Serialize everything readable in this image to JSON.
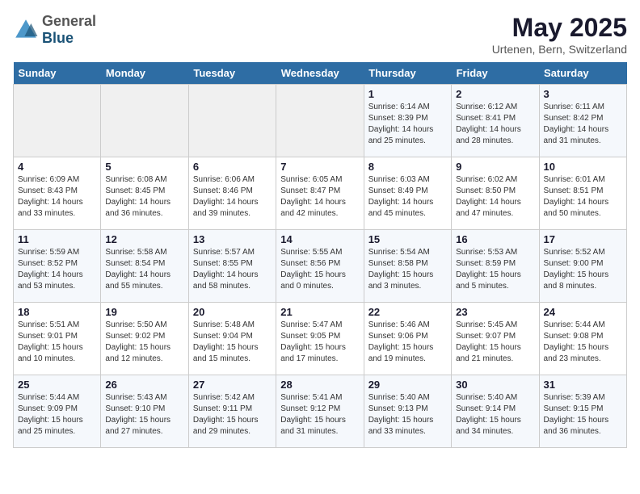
{
  "header": {
    "logo_general": "General",
    "logo_blue": "Blue",
    "month_title": "May 2025",
    "location": "Urtenen, Bern, Switzerland"
  },
  "days_of_week": [
    "Sunday",
    "Monday",
    "Tuesday",
    "Wednesday",
    "Thursday",
    "Friday",
    "Saturday"
  ],
  "weeks": [
    [
      {
        "day": "",
        "info": ""
      },
      {
        "day": "",
        "info": ""
      },
      {
        "day": "",
        "info": ""
      },
      {
        "day": "",
        "info": ""
      },
      {
        "day": "1",
        "info": "Sunrise: 6:14 AM\nSunset: 8:39 PM\nDaylight: 14 hours\nand 25 minutes."
      },
      {
        "day": "2",
        "info": "Sunrise: 6:12 AM\nSunset: 8:41 PM\nDaylight: 14 hours\nand 28 minutes."
      },
      {
        "day": "3",
        "info": "Sunrise: 6:11 AM\nSunset: 8:42 PM\nDaylight: 14 hours\nand 31 minutes."
      }
    ],
    [
      {
        "day": "4",
        "info": "Sunrise: 6:09 AM\nSunset: 8:43 PM\nDaylight: 14 hours\nand 33 minutes."
      },
      {
        "day": "5",
        "info": "Sunrise: 6:08 AM\nSunset: 8:45 PM\nDaylight: 14 hours\nand 36 minutes."
      },
      {
        "day": "6",
        "info": "Sunrise: 6:06 AM\nSunset: 8:46 PM\nDaylight: 14 hours\nand 39 minutes."
      },
      {
        "day": "7",
        "info": "Sunrise: 6:05 AM\nSunset: 8:47 PM\nDaylight: 14 hours\nand 42 minutes."
      },
      {
        "day": "8",
        "info": "Sunrise: 6:03 AM\nSunset: 8:49 PM\nDaylight: 14 hours\nand 45 minutes."
      },
      {
        "day": "9",
        "info": "Sunrise: 6:02 AM\nSunset: 8:50 PM\nDaylight: 14 hours\nand 47 minutes."
      },
      {
        "day": "10",
        "info": "Sunrise: 6:01 AM\nSunset: 8:51 PM\nDaylight: 14 hours\nand 50 minutes."
      }
    ],
    [
      {
        "day": "11",
        "info": "Sunrise: 5:59 AM\nSunset: 8:52 PM\nDaylight: 14 hours\nand 53 minutes."
      },
      {
        "day": "12",
        "info": "Sunrise: 5:58 AM\nSunset: 8:54 PM\nDaylight: 14 hours\nand 55 minutes."
      },
      {
        "day": "13",
        "info": "Sunrise: 5:57 AM\nSunset: 8:55 PM\nDaylight: 14 hours\nand 58 minutes."
      },
      {
        "day": "14",
        "info": "Sunrise: 5:55 AM\nSunset: 8:56 PM\nDaylight: 15 hours\nand 0 minutes."
      },
      {
        "day": "15",
        "info": "Sunrise: 5:54 AM\nSunset: 8:58 PM\nDaylight: 15 hours\nand 3 minutes."
      },
      {
        "day": "16",
        "info": "Sunrise: 5:53 AM\nSunset: 8:59 PM\nDaylight: 15 hours\nand 5 minutes."
      },
      {
        "day": "17",
        "info": "Sunrise: 5:52 AM\nSunset: 9:00 PM\nDaylight: 15 hours\nand 8 minutes."
      }
    ],
    [
      {
        "day": "18",
        "info": "Sunrise: 5:51 AM\nSunset: 9:01 PM\nDaylight: 15 hours\nand 10 minutes."
      },
      {
        "day": "19",
        "info": "Sunrise: 5:50 AM\nSunset: 9:02 PM\nDaylight: 15 hours\nand 12 minutes."
      },
      {
        "day": "20",
        "info": "Sunrise: 5:48 AM\nSunset: 9:04 PM\nDaylight: 15 hours\nand 15 minutes."
      },
      {
        "day": "21",
        "info": "Sunrise: 5:47 AM\nSunset: 9:05 PM\nDaylight: 15 hours\nand 17 minutes."
      },
      {
        "day": "22",
        "info": "Sunrise: 5:46 AM\nSunset: 9:06 PM\nDaylight: 15 hours\nand 19 minutes."
      },
      {
        "day": "23",
        "info": "Sunrise: 5:45 AM\nSunset: 9:07 PM\nDaylight: 15 hours\nand 21 minutes."
      },
      {
        "day": "24",
        "info": "Sunrise: 5:44 AM\nSunset: 9:08 PM\nDaylight: 15 hours\nand 23 minutes."
      }
    ],
    [
      {
        "day": "25",
        "info": "Sunrise: 5:44 AM\nSunset: 9:09 PM\nDaylight: 15 hours\nand 25 minutes."
      },
      {
        "day": "26",
        "info": "Sunrise: 5:43 AM\nSunset: 9:10 PM\nDaylight: 15 hours\nand 27 minutes."
      },
      {
        "day": "27",
        "info": "Sunrise: 5:42 AM\nSunset: 9:11 PM\nDaylight: 15 hours\nand 29 minutes."
      },
      {
        "day": "28",
        "info": "Sunrise: 5:41 AM\nSunset: 9:12 PM\nDaylight: 15 hours\nand 31 minutes."
      },
      {
        "day": "29",
        "info": "Sunrise: 5:40 AM\nSunset: 9:13 PM\nDaylight: 15 hours\nand 33 minutes."
      },
      {
        "day": "30",
        "info": "Sunrise: 5:40 AM\nSunset: 9:14 PM\nDaylight: 15 hours\nand 34 minutes."
      },
      {
        "day": "31",
        "info": "Sunrise: 5:39 AM\nSunset: 9:15 PM\nDaylight: 15 hours\nand 36 minutes."
      }
    ]
  ]
}
